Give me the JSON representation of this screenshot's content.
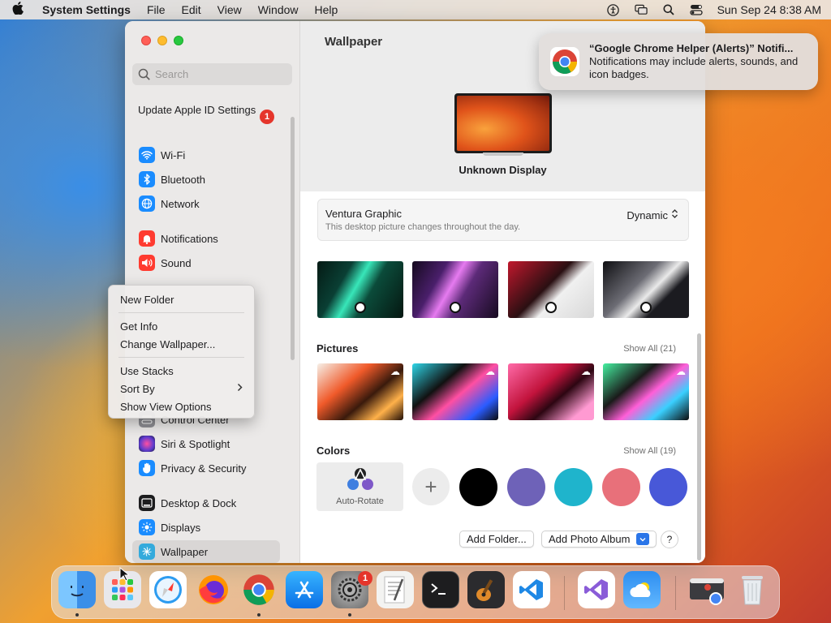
{
  "menubar": {
    "app": "System Settings",
    "items": [
      "File",
      "Edit",
      "View",
      "Window",
      "Help"
    ],
    "clock": "Sun Sep 24  8:38 AM"
  },
  "sidebar": {
    "search_placeholder": "Search",
    "apple_id": "Update Apple ID Settings",
    "apple_id_badge": "1",
    "items": [
      {
        "label": "Wi-Fi",
        "icon": "wifi-icon",
        "color": "#1a8cff"
      },
      {
        "label": "Bluetooth",
        "icon": "bluetooth-icon",
        "color": "#1a8cff"
      },
      {
        "label": "Network",
        "icon": "globe-icon",
        "color": "#1a8cff"
      },
      {
        "label": "Notifications",
        "icon": "bell-icon",
        "color": "#ff3b30"
      },
      {
        "label": "Sound",
        "icon": "speaker-icon",
        "color": "#ff3b30"
      },
      {
        "label": "Control Center",
        "icon": "toggles-icon",
        "color": "#8e8e93"
      },
      {
        "label": "Siri & Spotlight",
        "icon": "siri-icon",
        "color": "#5e3ccf"
      },
      {
        "label": "Privacy & Security",
        "icon": "hand-icon",
        "color": "#1a8cff"
      },
      {
        "label": "Desktop & Dock",
        "icon": "dock-icon",
        "color": "#1c1c1e"
      },
      {
        "label": "Displays",
        "icon": "sun-icon",
        "color": "#1a8cff"
      },
      {
        "label": "Wallpaper",
        "icon": "wallpaper-icon",
        "color": "#34aadc",
        "selected": true
      }
    ]
  },
  "main": {
    "title": "Wallpaper",
    "display_name": "Unknown Display",
    "wallpaper_name": "Ventura Graphic",
    "wallpaper_desc": "This desktop picture changes throughout the day.",
    "mode": "Dynamic",
    "pictures_title": "Pictures",
    "pictures_show_all": "Show All (21)",
    "colors_title": "Colors",
    "colors_show_all": "Show All (19)",
    "auto_rotate": "Auto-Rotate",
    "swatches": [
      "#000000",
      "#6e62b8",
      "#1fb4cc",
      "#e8707a",
      "#4858d8"
    ],
    "add_folder": "Add Folder...",
    "add_photo_album": "Add Photo Album",
    "help": "?"
  },
  "context_menu": {
    "items": [
      "New Folder",
      "Get Info",
      "Change Wallpaper...",
      "Use Stacks",
      "Sort By",
      "Show View Options"
    ]
  },
  "notification": {
    "title": "“Google Chrome Helper (Alerts)” Notifi...",
    "body": "Notifications may include alerts, sounds, and icon badges."
  },
  "dock": {
    "apps": [
      "finder-icon",
      "launchpad-icon",
      "safari-icon",
      "firefox-icon",
      "chrome-icon",
      "app-store-icon",
      "system-settings-icon",
      "textedit-icon",
      "terminal-icon",
      "garageband-icon",
      "vscode-icon",
      "visual-studio-icon",
      "weather-icon",
      "chrome-helper-icon",
      "trash-icon"
    ],
    "settings_badge": "1"
  }
}
